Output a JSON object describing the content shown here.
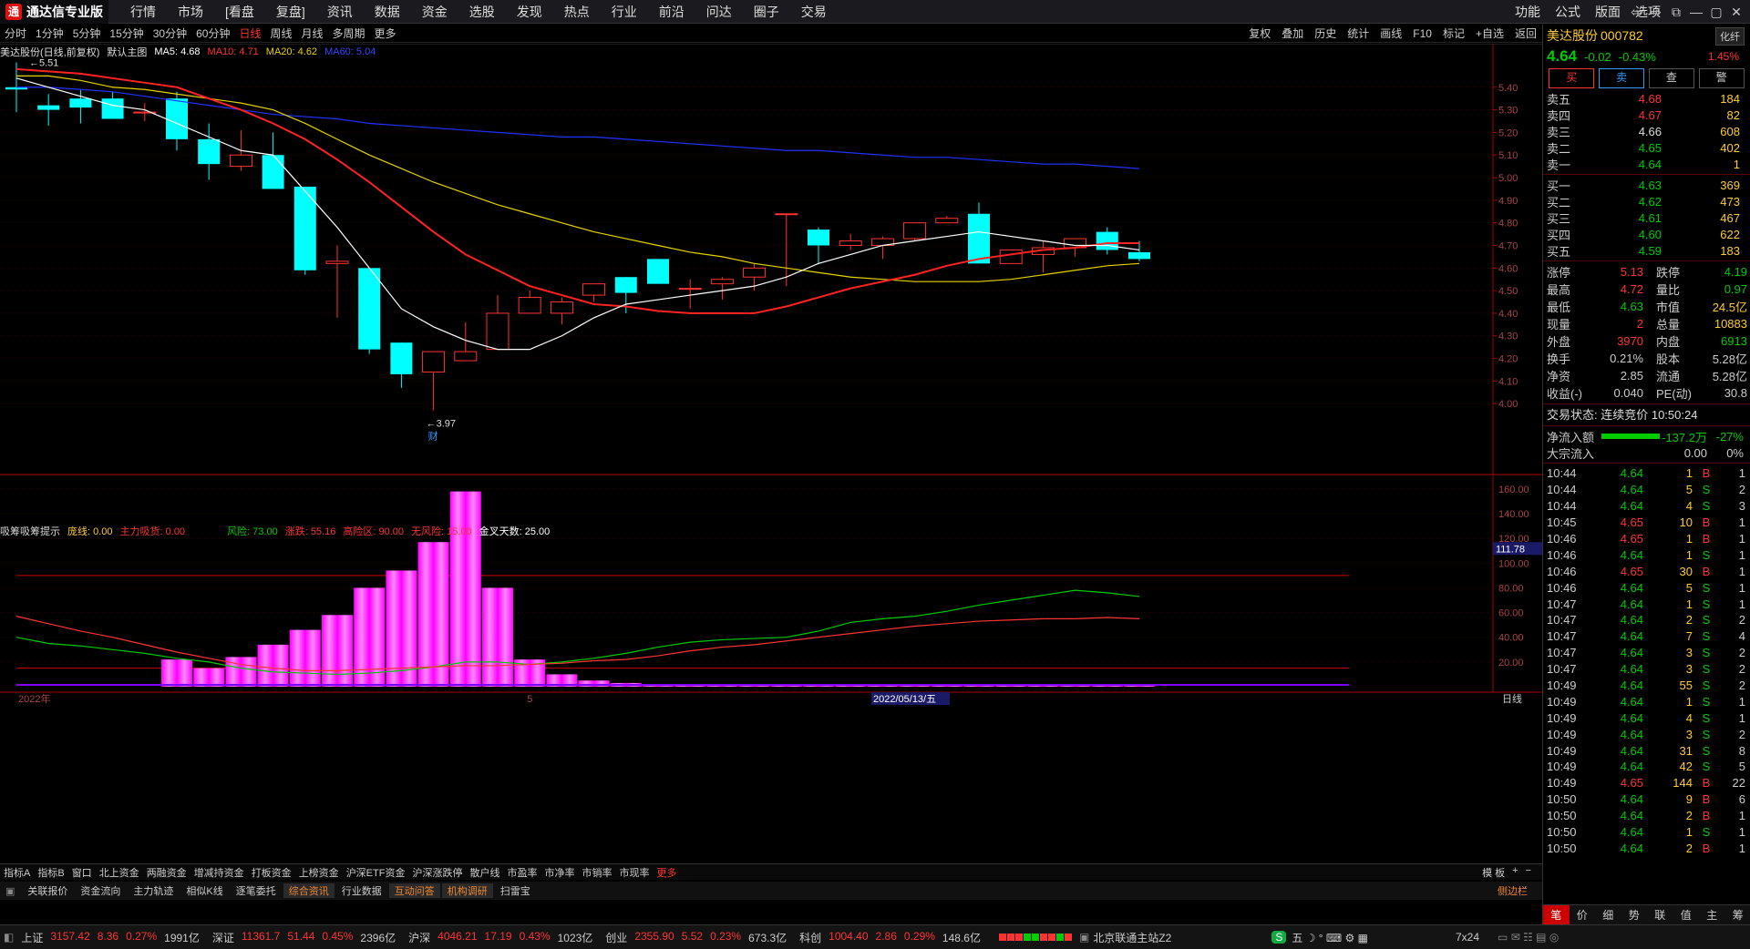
{
  "app": {
    "title": "通达信专业版",
    "logo": "通"
  },
  "menu": [
    "行情",
    "市场",
    "[看盘",
    "复盘]",
    "资讯",
    "数据",
    "资金",
    "选股",
    "发现",
    "热点",
    "行业",
    "前沿",
    "问达",
    "圈子",
    "交易"
  ],
  "right_menu": [
    "功能",
    "公式",
    "版面",
    "选项"
  ],
  "window_controls": [
    "⇦",
    "⇨",
    "⧉",
    "—",
    "▢",
    "✕"
  ],
  "periods": [
    "分时",
    "1分钟",
    "5分钟",
    "15分钟",
    "30分钟",
    "60分钟",
    "日线",
    "周线",
    "月线",
    "多周期",
    "更多"
  ],
  "active_period": "日线",
  "tools": [
    "复权",
    "叠加",
    "历史",
    "统计",
    "画线",
    "F10",
    "标记",
    "+自选",
    "返回"
  ],
  "info": {
    "stock": "美达股份(日线,前复权)",
    "theme": "默认主图",
    "ma5": "MA5: 4.68",
    "ma10": "MA10: 4.71",
    "ma20": "MA20: 4.62",
    "ma60": "MA60: 5.04"
  },
  "price_axis": [
    "5.40",
    "5.30",
    "5.20",
    "5.10",
    "5.00",
    "4.90",
    "4.80",
    "4.70",
    "4.60",
    "4.50",
    "4.40",
    "4.30",
    "4.20",
    "4.10",
    "4.00"
  ],
  "indicator_axis": [
    "160.00",
    "140.00",
    "120.00",
    "100.00",
    "80.00",
    "60.00",
    "40.00",
    "20.00"
  ],
  "indicator_current": "111.78",
  "high_label": "5.51",
  "low_label": "3.97",
  "low_tag": "财",
  "indicator_info": {
    "name": "吸筹吸筹提示",
    "l1": "庞线: 0.00",
    "l2": "主力吸货: 0.00",
    "l3": "风险: 73.00",
    "l4": "涨跌: 55.16",
    "l5": "高险区: 90.00",
    "l6": "无风险: 15.00",
    "l7": "金叉天数: 25.00"
  },
  "date_axis": {
    "year": "2022年",
    "month": "5",
    "cursor": "2022/05/13/五",
    "period": "日线"
  },
  "bottom_tabs": [
    "指标A",
    "指标B",
    "窗口",
    "北上资金",
    "两融资金",
    "增减持资金",
    "打板资金",
    "上榜资金",
    "沪深ETF资金",
    "沪深涨跌停",
    "散户线",
    "市盈率",
    "市净率",
    "市销率",
    "市现率",
    "更多"
  ],
  "bottom_right": [
    "模 板",
    "+",
    "−"
  ],
  "bottom_tabs2": [
    "关联报价",
    "资金流向",
    "主力轨迹",
    "相似K线",
    "逐笔委托",
    "综合资讯",
    "行业数据",
    "互动问答",
    "机构调研",
    "扫雷宝"
  ],
  "bottom_tabs2_hl": [
    "综合资讯",
    "互动问答",
    "机构调研"
  ],
  "sidebar_label": "侧边栏",
  "status": [
    {
      "n": "上证",
      "v": "3157.42",
      "d": "8.36",
      "p": "0.27%",
      "a": "1991亿"
    },
    {
      "n": "深证",
      "v": "11361.7",
      "d": "51.44",
      "p": "0.45%",
      "a": "2396亿"
    },
    {
      "n": "沪深",
      "v": "4046.21",
      "d": "17.19",
      "p": "0.43%",
      "a": "1023亿"
    },
    {
      "n": "创业",
      "v": "2355.90",
      "d": "5.52",
      "p": "0.23%",
      "a": "673.3亿"
    },
    {
      "n": "科创",
      "v": "1004.40",
      "d": "2.86",
      "p": "0.29%",
      "a": "148.6亿"
    }
  ],
  "server": "北京联通主站Z2",
  "clock": "7x24",
  "quote": {
    "name": "美达股份",
    "code": "000782",
    "btn": "化纤",
    "price": "4.64",
    "chg": "-0.02",
    "pct": "-0.43%",
    "rate": "1.45%"
  },
  "trade_btns": [
    "买",
    "卖",
    "查",
    "警"
  ],
  "sells": [
    [
      "卖五",
      "4.68",
      "184"
    ],
    [
      "卖四",
      "4.67",
      "82"
    ],
    [
      "卖三",
      "4.66",
      "608"
    ],
    [
      "卖二",
      "4.65",
      "402"
    ],
    [
      "卖一",
      "4.64",
      "1"
    ]
  ],
  "buys": [
    [
      "买一",
      "4.63",
      "369"
    ],
    [
      "买二",
      "4.62",
      "473"
    ],
    [
      "买三",
      "4.61",
      "467"
    ],
    [
      "买四",
      "4.60",
      "622"
    ],
    [
      "买五",
      "4.59",
      "183"
    ]
  ],
  "stats": [
    [
      "涨停",
      "5.13",
      "跌停",
      "4.19"
    ],
    [
      "最高",
      "4.72",
      "量比",
      "0.97"
    ],
    [
      "最低",
      "4.63",
      "市值",
      "24.5亿"
    ],
    [
      "现量",
      "2",
      "总量",
      "10883"
    ],
    [
      "外盘",
      "3970",
      "内盘",
      "6913"
    ],
    [
      "换手",
      "0.21%",
      "股本",
      "5.28亿"
    ],
    [
      "净资",
      "2.85",
      "流通",
      "5.28亿"
    ],
    [
      "收益(-)",
      "0.040",
      "PE(动)",
      "30.8"
    ]
  ],
  "trade_status": "交易状态: 连续竞价 10:50:24",
  "netflow": {
    "label": "净流入额",
    "value": "-137.2万",
    "pct": "-27%"
  },
  "bigflow": {
    "label": "大宗流入",
    "value": "0.00",
    "pct": "0%"
  },
  "ticks": [
    [
      "10:44",
      "4.64",
      "1",
      "B",
      "1"
    ],
    [
      "10:44",
      "4.64",
      "5",
      "S",
      "2"
    ],
    [
      "10:44",
      "4.64",
      "4",
      "S",
      "3"
    ],
    [
      "10:45",
      "4.65",
      "10",
      "B",
      "1"
    ],
    [
      "10:46",
      "4.65",
      "1",
      "B",
      "1"
    ],
    [
      "10:46",
      "4.64",
      "1",
      "S",
      "1"
    ],
    [
      "10:46",
      "4.65",
      "30",
      "B",
      "1"
    ],
    [
      "10:46",
      "4.64",
      "5",
      "S",
      "1"
    ],
    [
      "10:47",
      "4.64",
      "1",
      "S",
      "1"
    ],
    [
      "10:47",
      "4.64",
      "2",
      "S",
      "2"
    ],
    [
      "10:47",
      "4.64",
      "7",
      "S",
      "4"
    ],
    [
      "10:47",
      "4.64",
      "3",
      "S",
      "2"
    ],
    [
      "10:47",
      "4.64",
      "3",
      "S",
      "2"
    ],
    [
      "10:49",
      "4.64",
      "55",
      "S",
      "2"
    ],
    [
      "10:49",
      "4.64",
      "1",
      "S",
      "1"
    ],
    [
      "10:49",
      "4.64",
      "4",
      "S",
      "1"
    ],
    [
      "10:49",
      "4.64",
      "3",
      "S",
      "2"
    ],
    [
      "10:49",
      "4.64",
      "31",
      "S",
      "8"
    ],
    [
      "10:49",
      "4.64",
      "42",
      "S",
      "5"
    ],
    [
      "10:49",
      "4.65",
      "144",
      "B",
      "22"
    ],
    [
      "10:50",
      "4.64",
      "9",
      "B",
      "6"
    ],
    [
      "10:50",
      "4.64",
      "2",
      "B",
      "1"
    ],
    [
      "10:50",
      "4.64",
      "1",
      "S",
      "1"
    ],
    [
      "10:50",
      "4.64",
      "2",
      "B",
      "1"
    ]
  ],
  "rp_tabs": [
    "笔",
    "价",
    "细",
    "势",
    "联",
    "值",
    "主",
    "筹"
  ],
  "colors": {
    "up": "#ff3333",
    "down": "#00ffff",
    "ma5": "#ffffff",
    "ma10": "#ff2222",
    "ma20": "#e6d300",
    "ma60": "#2030ff",
    "green": "#00cc00",
    "yellow": "#ffcc33",
    "magenta": "#ff00ff"
  },
  "chart_data": {
    "type": "candlestick",
    "candles": [
      [
        5.4,
        5.39,
        5.51,
        5.29
      ],
      [
        5.32,
        5.3,
        5.37,
        5.23
      ],
      [
        5.35,
        5.31,
        5.39,
        5.24
      ],
      [
        5.35,
        5.26,
        5.38,
        5.26
      ],
      [
        5.29,
        5.29,
        5.33,
        5.25
      ],
      [
        5.35,
        5.17,
        5.38,
        5.12
      ],
      [
        5.17,
        5.06,
        5.24,
        4.99
      ],
      [
        5.05,
        5.1,
        5.21,
        5.03
      ],
      [
        5.1,
        4.95,
        5.2,
        4.95
      ],
      [
        4.96,
        4.59,
        4.96,
        4.57
      ],
      [
        4.62,
        4.63,
        4.7,
        4.38
      ],
      [
        4.6,
        4.24,
        4.6,
        4.22
      ],
      [
        4.27,
        4.13,
        4.27,
        4.07
      ],
      [
        4.14,
        4.23,
        4.23,
        3.97
      ],
      [
        4.19,
        4.23,
        4.36,
        4.19
      ],
      [
        4.24,
        4.4,
        4.48,
        4.24
      ],
      [
        4.4,
        4.47,
        4.5,
        4.4
      ],
      [
        4.4,
        4.45,
        4.47,
        4.35
      ],
      [
        4.48,
        4.53,
        4.53,
        4.45
      ],
      [
        4.56,
        4.49,
        4.56,
        4.4
      ],
      [
        4.64,
        4.53,
        4.64,
        4.53
      ],
      [
        4.51,
        4.51,
        4.55,
        4.42
      ],
      [
        4.53,
        4.55,
        4.56,
        4.46
      ],
      [
        4.56,
        4.6,
        4.62,
        4.5
      ],
      [
        4.84,
        4.84,
        4.84,
        4.52
      ],
      [
        4.77,
        4.7,
        4.78,
        4.62
      ],
      [
        4.7,
        4.72,
        4.75,
        4.68
      ],
      [
        4.7,
        4.73,
        4.74,
        4.64
      ],
      [
        4.73,
        4.8,
        4.8,
        4.72
      ],
      [
        4.8,
        4.82,
        4.83,
        4.8
      ],
      [
        4.84,
        4.62,
        4.89,
        4.62
      ],
      [
        4.62,
        4.68,
        4.68,
        4.62
      ],
      [
        4.66,
        4.69,
        4.72,
        4.58
      ],
      [
        4.69,
        4.73,
        4.73,
        4.65
      ],
      [
        4.76,
        4.68,
        4.78,
        4.66
      ],
      [
        4.67,
        4.64,
        4.72,
        4.63
      ]
    ],
    "ma5": [
      5.44,
      5.4,
      5.36,
      5.32,
      5.3,
      5.24,
      5.18,
      5.12,
      5.1,
      4.94,
      4.78,
      4.6,
      4.42,
      4.34,
      4.28,
      4.24,
      4.24,
      4.3,
      4.38,
      4.44,
      4.46,
      4.48,
      4.5,
      4.52,
      4.56,
      4.62,
      4.66,
      4.7,
      4.72,
      4.74,
      4.76,
      4.74,
      4.72,
      4.7,
      4.7,
      4.68
    ],
    "ma10": [
      5.48,
      5.47,
      5.46,
      5.44,
      5.42,
      5.4,
      5.35,
      5.3,
      5.24,
      5.17,
      5.08,
      4.98,
      4.87,
      4.76,
      4.66,
      4.59,
      4.52,
      4.48,
      4.44,
      4.43,
      4.41,
      4.4,
      4.4,
      4.4,
      4.43,
      4.47,
      4.51,
      4.54,
      4.57,
      4.61,
      4.64,
      4.66,
      4.68,
      4.69,
      4.71,
      4.71
    ],
    "ma20": [
      5.45,
      5.45,
      5.43,
      5.4,
      5.39,
      5.37,
      5.35,
      5.33,
      5.3,
      5.24,
      5.17,
      5.1,
      5.04,
      4.98,
      4.93,
      4.88,
      4.84,
      4.8,
      4.76,
      4.73,
      4.7,
      4.67,
      4.65,
      4.62,
      4.6,
      4.58,
      4.56,
      4.55,
      4.54,
      4.54,
      4.54,
      4.55,
      4.57,
      4.59,
      4.61,
      4.62
    ],
    "ma60": [
      5.4,
      5.4,
      5.39,
      5.38,
      5.36,
      5.34,
      5.32,
      5.3,
      5.28,
      5.27,
      5.26,
      5.24,
      5.23,
      5.22,
      5.21,
      5.2,
      5.19,
      5.18,
      5.18,
      5.17,
      5.16,
      5.15,
      5.14,
      5.13,
      5.12,
      5.12,
      5.11,
      5.1,
      5.09,
      5.09,
      5.08,
      5.07,
      5.06,
      5.06,
      5.05,
      5.04
    ],
    "indicator": {
      "bars": [
        0,
        0,
        0,
        0,
        0,
        22,
        15,
        24,
        34,
        46,
        58,
        80,
        94,
        117,
        158,
        80,
        22,
        10,
        5,
        3,
        2,
        1,
        1,
        1,
        1,
        1,
        1,
        1,
        1,
        1,
        1,
        1,
        1,
        1,
        1,
        1
      ],
      "green": [
        40,
        35,
        33,
        30,
        27,
        23,
        20,
        15,
        12,
        11,
        10,
        11,
        13,
        16,
        20,
        20,
        18,
        20,
        23,
        27,
        32,
        36,
        38,
        39,
        40,
        45,
        52,
        55,
        57,
        61,
        66,
        70,
        74,
        78,
        76,
        73
      ],
      "red": [
        57,
        51,
        45,
        40,
        34,
        28,
        23,
        18,
        15,
        13,
        13,
        14,
        15,
        16,
        17,
        17,
        18,
        19,
        21,
        22,
        25,
        29,
        32,
        34,
        37,
        40,
        43,
        46,
        49,
        51,
        53,
        54,
        55,
        55,
        56,
        55
      ],
      "line_high": 90,
      "line_low": 15,
      "ylim": [
        0,
        168
      ]
    },
    "ylim": [
      3.9,
      5.52
    ]
  }
}
